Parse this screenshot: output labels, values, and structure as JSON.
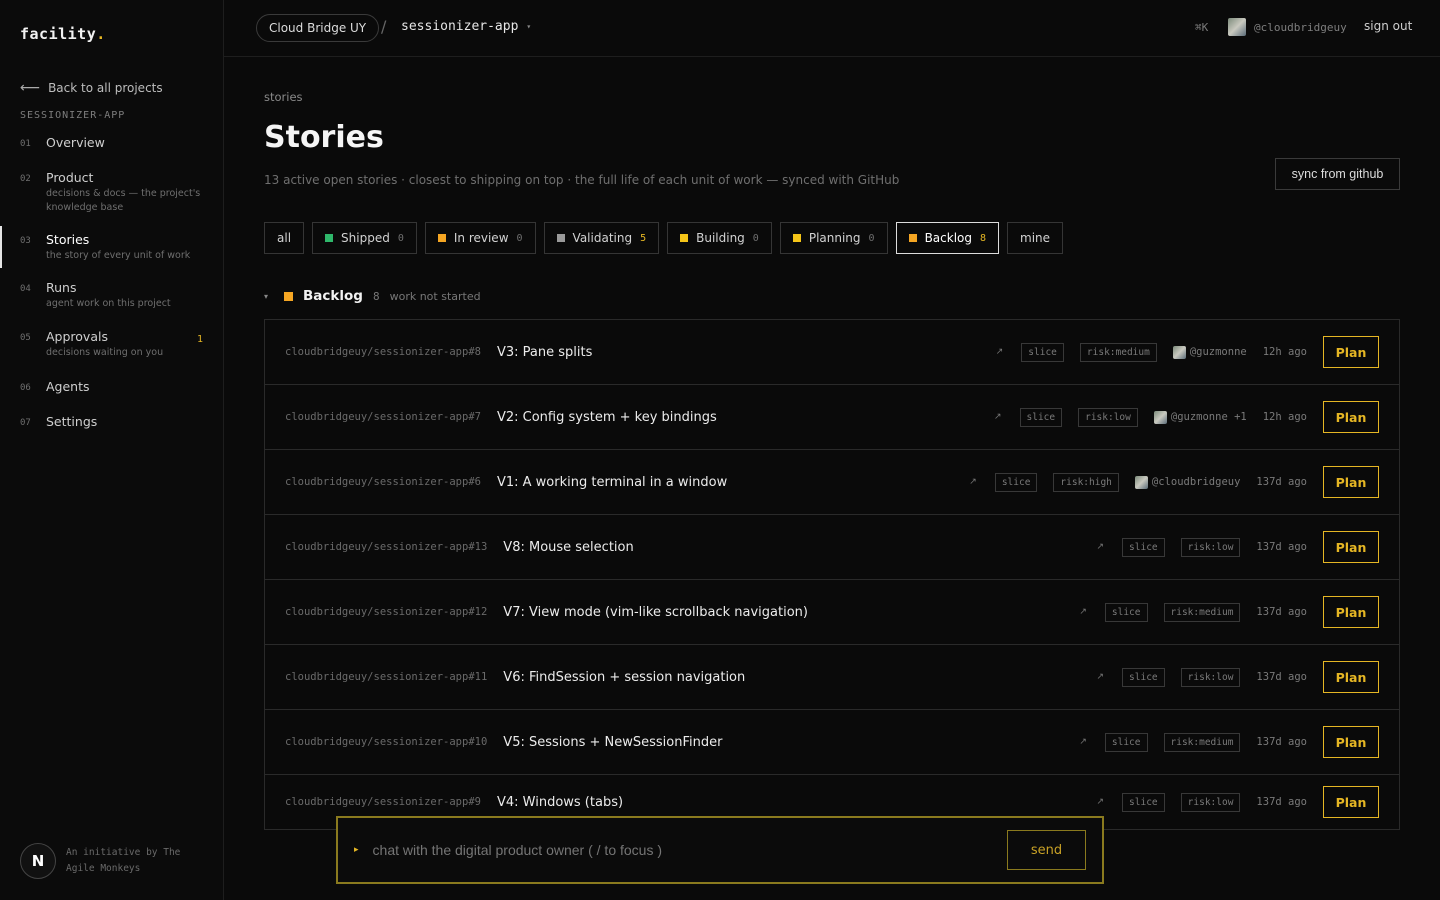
{
  "sidebar": {
    "logo": "facility",
    "logo_dot": ".",
    "back_label": "Back to all projects",
    "project_label": "SESSIONIZER-APP",
    "items": [
      {
        "num": "01",
        "label": "Overview",
        "sub": "",
        "badge": ""
      },
      {
        "num": "02",
        "label": "Product",
        "sub": "decisions & docs — the project's knowledge base",
        "badge": ""
      },
      {
        "num": "03",
        "label": "Stories",
        "sub": "the story of every unit of work",
        "badge": ""
      },
      {
        "num": "04",
        "label": "Runs",
        "sub": "agent work on this project",
        "badge": ""
      },
      {
        "num": "05",
        "label": "Approvals",
        "sub": "decisions waiting on you",
        "badge": "1"
      },
      {
        "num": "06",
        "label": "Agents",
        "sub": "",
        "badge": ""
      },
      {
        "num": "07",
        "label": "Settings",
        "sub": "",
        "badge": ""
      }
    ],
    "footer_initial": "N",
    "footer_line1": "An initiative by The",
    "footer_line2": "Agile Monkeys"
  },
  "topbar": {
    "org": "Cloud Bridge UY",
    "slash": "/",
    "app": "sessionizer-app",
    "caret": "▾",
    "shortcut": "⌘K",
    "user": "@cloudbridgeuy",
    "signout": "sign out"
  },
  "page": {
    "crumb": "stories",
    "title": "Stories",
    "subtitle": "13 active open stories · closest to shipping on top · the full life of each unit of work — synced with GitHub",
    "sync_label": "sync from github"
  },
  "filters": [
    {
      "label": "all",
      "count": "",
      "color": ""
    },
    {
      "label": "Shipped",
      "count": "0",
      "color": "#2fb86b"
    },
    {
      "label": "In review",
      "count": "0",
      "color": "#f5a623"
    },
    {
      "label": "Validating",
      "count": "5",
      "color": "#9a9a9a"
    },
    {
      "label": "Building",
      "count": "0",
      "color": "#f5c518"
    },
    {
      "label": "Planning",
      "count": "0",
      "color": "#f5c518"
    },
    {
      "label": "Backlog",
      "count": "8",
      "color": "#f5a623"
    },
    {
      "label": "mine",
      "count": "",
      "color": ""
    }
  ],
  "group": {
    "tri": "▾",
    "name": "Backlog",
    "count": "8",
    "desc": "work not started"
  },
  "stories": [
    {
      "ref": "cloudbridgeuy/sessionizer-app#8",
      "title": "V3: Pane splits",
      "ext": "↗",
      "tag1": "slice",
      "tag2": "risk:medium",
      "who": "@guzmonne",
      "time": "12h ago",
      "action": "Plan"
    },
    {
      "ref": "cloudbridgeuy/sessionizer-app#7",
      "title": "V2: Config system + key bindings",
      "ext": "↗",
      "tag1": "slice",
      "tag2": "risk:low",
      "who": "@guzmonne +1",
      "time": "12h ago",
      "action": "Plan"
    },
    {
      "ref": "cloudbridgeuy/sessionizer-app#6",
      "title": "V1: A working terminal in a window",
      "ext": "↗",
      "tag1": "slice",
      "tag2": "risk:high",
      "who": "@cloudbridgeuy",
      "time": "137d ago",
      "action": "Plan"
    },
    {
      "ref": "cloudbridgeuy/sessionizer-app#13",
      "title": "V8: Mouse selection",
      "ext": "↗",
      "tag1": "slice",
      "tag2": "risk:low",
      "who": "",
      "time": "137d ago",
      "action": "Plan"
    },
    {
      "ref": "cloudbridgeuy/sessionizer-app#12",
      "title": "V7: View mode (vim-like scrollback navigation)",
      "ext": "↗",
      "tag1": "slice",
      "tag2": "risk:medium",
      "who": "",
      "time": "137d ago",
      "action": "Plan"
    },
    {
      "ref": "cloudbridgeuy/sessionizer-app#11",
      "title": "V6: FindSession + session navigation",
      "ext": "↗",
      "tag1": "slice",
      "tag2": "risk:low",
      "who": "",
      "time": "137d ago",
      "action": "Plan"
    },
    {
      "ref": "cloudbridgeuy/sessionizer-app#10",
      "title": "V5: Sessions + NewSessionFinder",
      "ext": "↗",
      "tag1": "slice",
      "tag2": "risk:medium",
      "who": "",
      "time": "137d ago",
      "action": "Plan"
    },
    {
      "ref": "cloudbridgeuy/sessionizer-app#9",
      "title": "V4: Windows (tabs)",
      "ext": "↗",
      "tag1": "slice",
      "tag2": "risk:low",
      "who": "",
      "time": "137d ago",
      "action": "Plan"
    }
  ],
  "chat": {
    "tri": "▸",
    "placeholder": "chat with the digital product owner ( / to focus )",
    "send": "send"
  },
  "colors": {
    "accent": "#e5b624",
    "background": "#0a0a0a"
  }
}
